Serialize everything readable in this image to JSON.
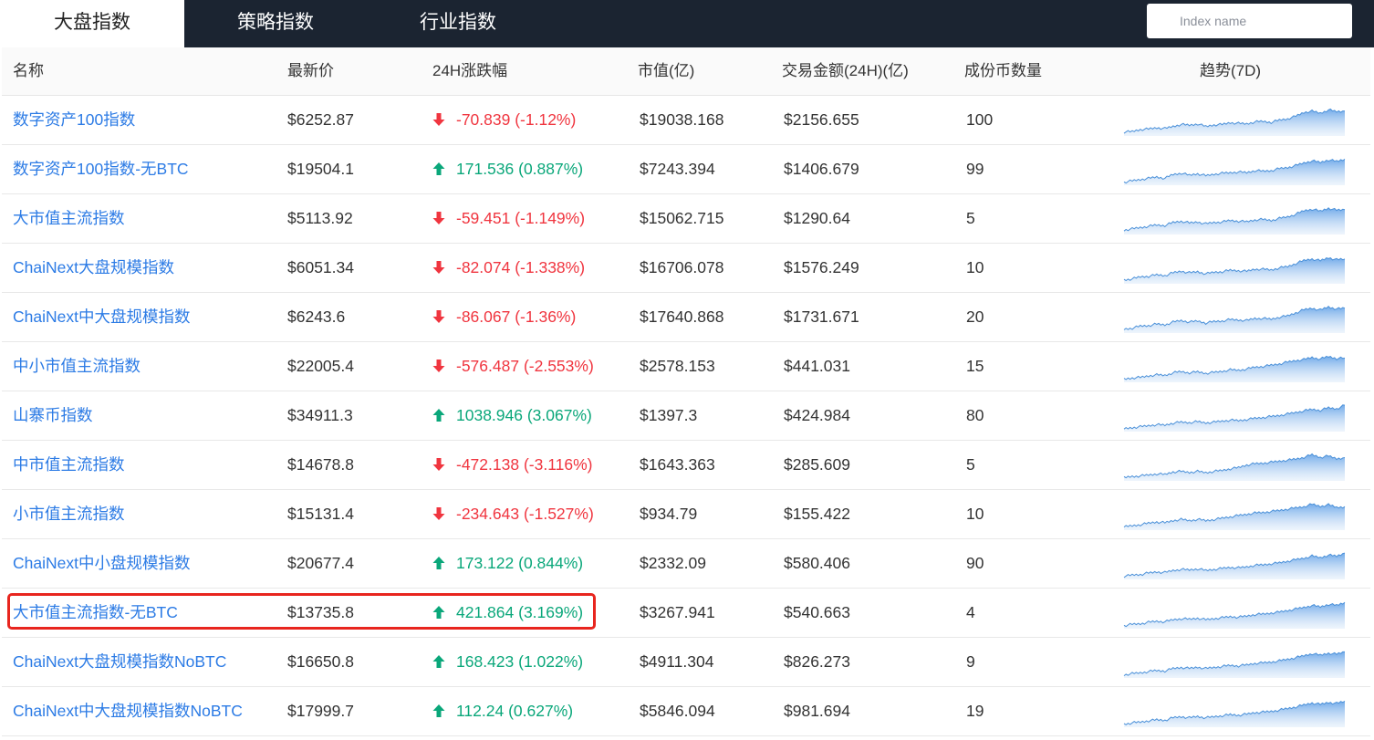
{
  "tabs": [
    {
      "label": "大盘指数",
      "active": true
    },
    {
      "label": "策略指数",
      "active": false
    },
    {
      "label": "行业指数",
      "active": false
    }
  ],
  "search": {
    "placeholder": "Index name",
    "value": ""
  },
  "columns": {
    "name": "名称",
    "price": "最新价",
    "change": "24H涨跌幅",
    "mcap": "市值(亿)",
    "volume": "交易金额(24H)(亿)",
    "count": "成份币数量",
    "trend": "趋势(7D)"
  },
  "colors": {
    "up": "#0aa77a",
    "down": "#f0353f",
    "link": "#2c7be5",
    "highlight": "#e8251e",
    "sparkline": "#4a90d9"
  },
  "rows": [
    {
      "name": "数字资产100指数",
      "price": "$6252.87",
      "change": "-70.839 (-1.12%)",
      "direction": "down",
      "mcap": "$19038.168",
      "volume": "$2156.655",
      "count": "100",
      "spark": [
        0.08,
        0.1,
        0.18,
        0.2,
        0.25,
        0.22,
        0.3,
        0.38,
        0.35,
        0.4,
        0.3,
        0.36,
        0.38,
        0.45,
        0.42,
        0.4,
        0.48,
        0.5,
        0.46,
        0.55,
        0.6,
        0.7,
        0.85,
        0.9,
        0.82,
        0.95,
        0.88,
        0.9
      ]
    },
    {
      "name": "数字资产100指数-无BTC",
      "price": "$19504.1",
      "change": "171.536 (0.887%)",
      "direction": "up",
      "mcap": "$7243.394",
      "volume": "$1406.679",
      "count": "99",
      "spark": [
        0.05,
        0.1,
        0.15,
        0.2,
        0.25,
        0.2,
        0.35,
        0.4,
        0.32,
        0.38,
        0.3,
        0.36,
        0.4,
        0.42,
        0.45,
        0.42,
        0.5,
        0.48,
        0.5,
        0.58,
        0.62,
        0.7,
        0.8,
        0.88,
        0.82,
        0.92,
        0.86,
        0.95
      ]
    },
    {
      "name": "大市值主流指数",
      "price": "$5113.92",
      "change": "-59.451 (-1.149%)",
      "direction": "down",
      "mcap": "$15062.715",
      "volume": "$1290.64",
      "count": "5",
      "spark": [
        0.1,
        0.15,
        0.2,
        0.25,
        0.3,
        0.28,
        0.4,
        0.45,
        0.38,
        0.42,
        0.35,
        0.4,
        0.42,
        0.48,
        0.45,
        0.43,
        0.5,
        0.52,
        0.48,
        0.56,
        0.62,
        0.72,
        0.86,
        0.92,
        0.84,
        0.96,
        0.88,
        0.9
      ]
    },
    {
      "name": "ChaiNext大盘规模指数",
      "price": "$6051.34",
      "change": "-82.074 (-1.338%)",
      "direction": "down",
      "mcap": "$16706.078",
      "volume": "$1576.249",
      "count": "10",
      "spark": [
        0.08,
        0.12,
        0.2,
        0.22,
        0.28,
        0.25,
        0.36,
        0.42,
        0.36,
        0.4,
        0.32,
        0.38,
        0.4,
        0.46,
        0.44,
        0.42,
        0.5,
        0.5,
        0.47,
        0.55,
        0.6,
        0.72,
        0.84,
        0.9,
        0.83,
        0.95,
        0.87,
        0.9
      ]
    },
    {
      "name": "ChaiNext中大盘规模指数",
      "price": "$6243.6",
      "change": "-86.067 (-1.36%)",
      "direction": "down",
      "mcap": "$17640.868",
      "volume": "$1731.671",
      "count": "20",
      "spark": [
        0.08,
        0.12,
        0.2,
        0.22,
        0.28,
        0.25,
        0.36,
        0.42,
        0.36,
        0.4,
        0.32,
        0.38,
        0.4,
        0.46,
        0.44,
        0.42,
        0.5,
        0.5,
        0.47,
        0.55,
        0.6,
        0.72,
        0.84,
        0.9,
        0.83,
        0.95,
        0.87,
        0.9
      ]
    },
    {
      "name": "中小市值主流指数",
      "price": "$22005.4",
      "change": "-576.487 (-2.553%)",
      "direction": "down",
      "mcap": "$2578.153",
      "volume": "$441.031",
      "count": "15",
      "spark": [
        0.05,
        0.1,
        0.12,
        0.18,
        0.22,
        0.2,
        0.3,
        0.35,
        0.3,
        0.34,
        0.28,
        0.32,
        0.36,
        0.42,
        0.4,
        0.45,
        0.52,
        0.55,
        0.6,
        0.65,
        0.72,
        0.78,
        0.82,
        0.9,
        0.84,
        0.94,
        0.86,
        0.88
      ]
    },
    {
      "name": "山寨币指数",
      "price": "$34911.3",
      "change": "1038.946 (3.067%)",
      "direction": "up",
      "mcap": "$1397.3",
      "volume": "$424.984",
      "count": "80",
      "spark": [
        0.04,
        0.08,
        0.12,
        0.16,
        0.2,
        0.18,
        0.26,
        0.3,
        0.28,
        0.32,
        0.27,
        0.3,
        0.34,
        0.38,
        0.36,
        0.4,
        0.45,
        0.48,
        0.52,
        0.56,
        0.62,
        0.68,
        0.74,
        0.8,
        0.76,
        0.86,
        0.82,
        0.96
      ]
    },
    {
      "name": "中市值主流指数",
      "price": "$14678.8",
      "change": "-472.138 (-3.116%)",
      "direction": "down",
      "mcap": "$1643.363",
      "volume": "$285.609",
      "count": "5",
      "spark": [
        0.05,
        0.1,
        0.12,
        0.16,
        0.2,
        0.18,
        0.28,
        0.3,
        0.26,
        0.3,
        0.25,
        0.3,
        0.34,
        0.4,
        0.45,
        0.55,
        0.6,
        0.62,
        0.66,
        0.7,
        0.74,
        0.78,
        0.85,
        0.95,
        0.85,
        0.9,
        0.8,
        0.84
      ]
    },
    {
      "name": "小市值主流指数",
      "price": "$15131.4",
      "change": "-234.643 (-1.527%)",
      "direction": "down",
      "mcap": "$934.79",
      "volume": "$155.422",
      "count": "10",
      "spark": [
        0.05,
        0.1,
        0.14,
        0.2,
        0.25,
        0.22,
        0.3,
        0.35,
        0.3,
        0.35,
        0.3,
        0.34,
        0.4,
        0.45,
        0.5,
        0.55,
        0.6,
        0.62,
        0.66,
        0.7,
        0.75,
        0.8,
        0.85,
        0.94,
        0.86,
        0.92,
        0.82,
        0.85
      ]
    },
    {
      "name": "ChaiNext中小盘规模指数",
      "price": "$20677.4",
      "change": "173.122 (0.844%)",
      "direction": "up",
      "mcap": "$2332.09",
      "volume": "$580.406",
      "count": "90",
      "spark": [
        0.05,
        0.1,
        0.12,
        0.18,
        0.22,
        0.2,
        0.28,
        0.32,
        0.3,
        0.34,
        0.28,
        0.32,
        0.36,
        0.4,
        0.38,
        0.42,
        0.48,
        0.5,
        0.54,
        0.58,
        0.64,
        0.7,
        0.76,
        0.84,
        0.78,
        0.88,
        0.84,
        0.96
      ]
    },
    {
      "name": "大市值主流指数-无BTC",
      "price": "$13735.8",
      "change": "421.864 (3.169%)",
      "direction": "up",
      "mcap": "$3267.941",
      "volume": "$540.663",
      "count": "4",
      "highlight": true,
      "spark": [
        0.05,
        0.1,
        0.12,
        0.18,
        0.22,
        0.2,
        0.28,
        0.32,
        0.3,
        0.34,
        0.28,
        0.32,
        0.36,
        0.4,
        0.38,
        0.42,
        0.48,
        0.5,
        0.54,
        0.58,
        0.64,
        0.7,
        0.76,
        0.84,
        0.78,
        0.88,
        0.84,
        0.96
      ]
    },
    {
      "name": "ChaiNext大盘规模指数NoBTC",
      "price": "$16650.8",
      "change": "168.423 (1.022%)",
      "direction": "up",
      "mcap": "$4911.304",
      "volume": "$826.273",
      "count": "9",
      "spark": [
        0.05,
        0.1,
        0.13,
        0.18,
        0.22,
        0.2,
        0.3,
        0.34,
        0.3,
        0.35,
        0.3,
        0.34,
        0.38,
        0.42,
        0.4,
        0.44,
        0.5,
        0.52,
        0.55,
        0.6,
        0.66,
        0.72,
        0.8,
        0.88,
        0.82,
        0.9,
        0.86,
        0.95
      ]
    },
    {
      "name": "ChaiNext中大盘规模指数NoBTC",
      "price": "$17999.7",
      "change": "112.24 (0.627%)",
      "direction": "up",
      "mcap": "$5846.094",
      "volume": "$981.694",
      "count": "19",
      "spark": [
        0.05,
        0.1,
        0.13,
        0.18,
        0.22,
        0.2,
        0.3,
        0.34,
        0.3,
        0.35,
        0.3,
        0.34,
        0.38,
        0.42,
        0.4,
        0.44,
        0.5,
        0.52,
        0.55,
        0.6,
        0.66,
        0.72,
        0.8,
        0.88,
        0.82,
        0.9,
        0.86,
        0.95
      ]
    }
  ]
}
